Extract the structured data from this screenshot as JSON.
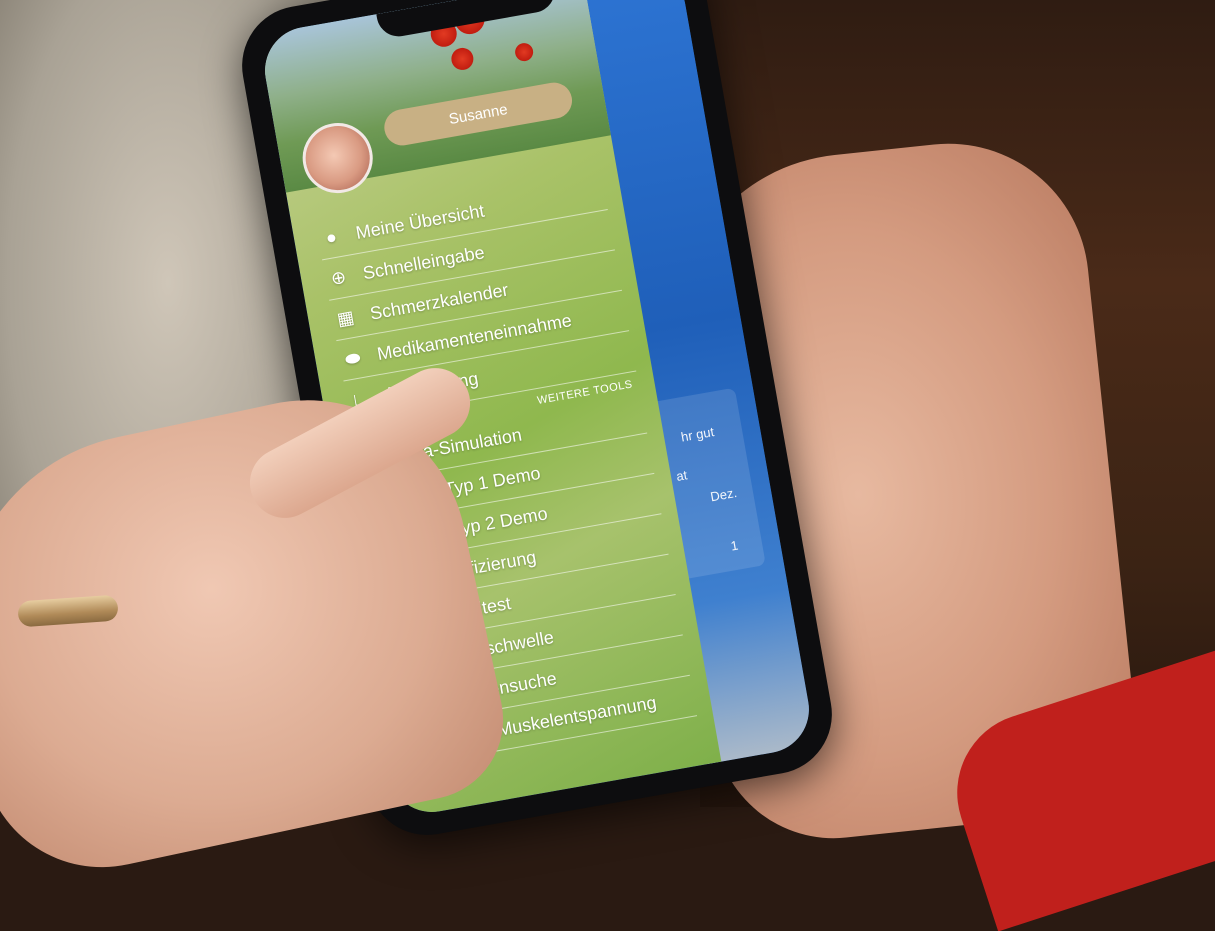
{
  "app": {
    "user_name": "Susanne"
  },
  "menu": {
    "items": [
      {
        "label": "Meine Übersicht",
        "icon": "user-icon"
      },
      {
        "label": "Schnelleingabe",
        "icon": "plus-circle-icon"
      },
      {
        "label": "Schmerzkalender",
        "icon": "calendar-icon"
      },
      {
        "label": "Medikamenteneinnahme",
        "icon": "pill-icon"
      },
      {
        "label": "Auswertung",
        "icon": "chart-icon"
      }
    ],
    "section_title": "WEITERE TOOLS",
    "tools": [
      {
        "label": "Aura-Simulation",
        "icon": "eye-icon"
      },
      {
        "label": "Aura Typ 1 Demo",
        "icon": "film-icon"
      },
      {
        "label": "Aura Typ 2 Demo",
        "icon": "film-icon"
      },
      {
        "label": "Chronifizierung",
        "icon": "hourglass-icon"
      },
      {
        "label": "Schnelltest",
        "icon": "check-circle-icon"
      },
      {
        "label": "Triptanschwelle",
        "icon": "flask-icon"
      },
      {
        "label": "Expertensuche",
        "icon": "location-icon"
      },
      {
        "label": "Progr. Muskelentspannung",
        "icon": "headphones-icon"
      }
    ]
  },
  "background_app": {
    "status_text": "hr gut",
    "label_at": "at",
    "month": "Dez.",
    "count": "1"
  }
}
